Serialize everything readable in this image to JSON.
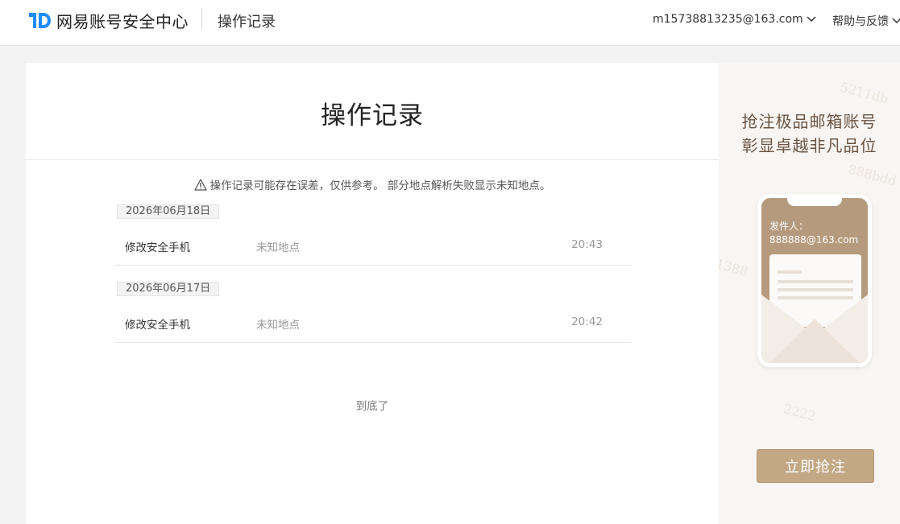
{
  "header": {
    "logo_text": "网易账号安全中心",
    "page_name": "操作记录",
    "account": "m15738813235@163.com",
    "help": "帮助与反馈"
  },
  "main": {
    "title": "操作记录",
    "notice": "操作记录可能存在误差，仅供参考。 部分地点解析失败显示未知地点。",
    "groups": [
      {
        "date": "2026年06月18日",
        "action": "修改安全手机",
        "location": "未知地点",
        "time": "20:43"
      },
      {
        "date": "2026年06月17日",
        "action": "修改安全手机",
        "location": "未知地点",
        "time": "20:42"
      }
    ],
    "end_text": "到底了"
  },
  "ad": {
    "line1": "抢注极品邮箱账号",
    "line2": "彰显卓越非凡品位",
    "phone_label": "发件人：",
    "phone_email": "888888@163.com",
    "button": "立即抢注",
    "watermarks": [
      "5211db",
      "888bdd",
      "2222",
      "1388"
    ]
  },
  "colors": {
    "accent_blue": "#1a8cff",
    "ad_gold": "#c3a886",
    "ad_text": "#6b5443"
  }
}
